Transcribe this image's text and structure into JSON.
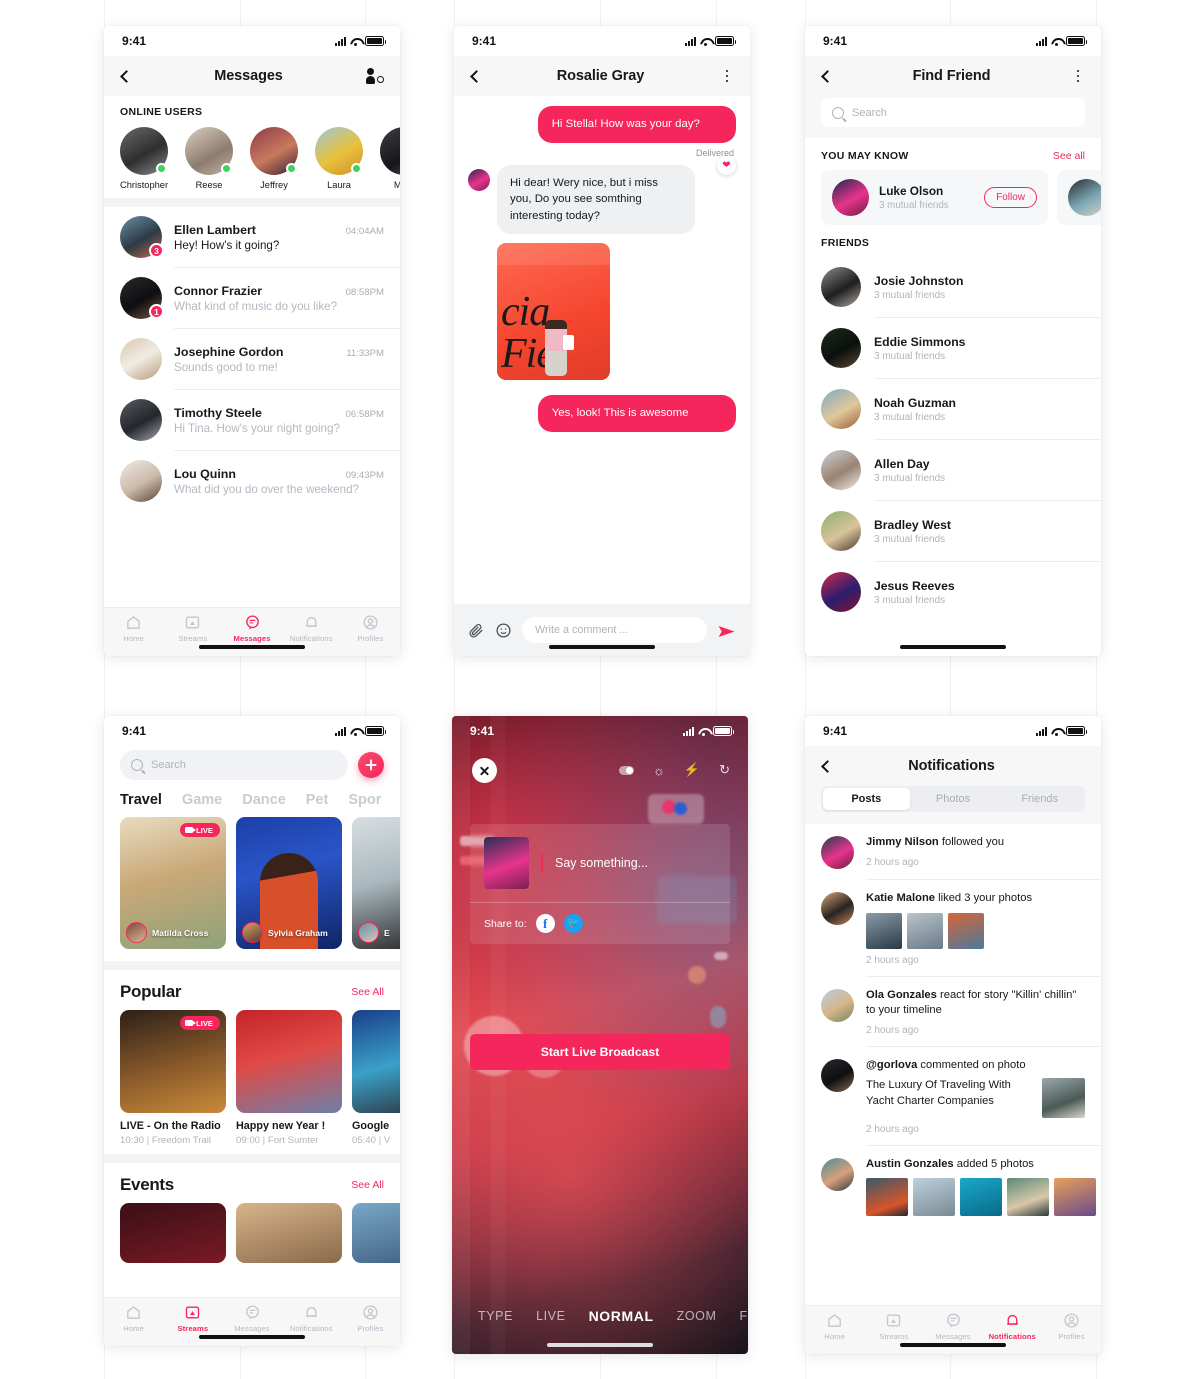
{
  "status_bar": {
    "time": "9:41"
  },
  "screen_messages": {
    "title": "Messages",
    "back_icon": "chevron-left-icon",
    "action_icon": "add-friend-icon",
    "online_label": "ONLINE USERS",
    "online_users": [
      {
        "name": "Christopher"
      },
      {
        "name": "Reese"
      },
      {
        "name": "Jeffrey"
      },
      {
        "name": "Laura"
      },
      {
        "name": "Mald"
      }
    ],
    "conversations": [
      {
        "name": "Ellen Lambert",
        "time": "04:04AM",
        "preview": "Hey! How's it going?",
        "badge": "3",
        "unread": true
      },
      {
        "name": "Connor Frazier",
        "time": "08:58PM",
        "preview": "What kind of music do you like?",
        "badge": "1",
        "unread": false
      },
      {
        "name": "Josephine Gordon",
        "time": "11:33PM",
        "preview": "Sounds good to me!",
        "badge": "",
        "unread": false
      },
      {
        "name": "Timothy Steele",
        "time": "06:58PM",
        "preview": "Hi Tina. How's your night going?",
        "badge": "",
        "unread": false
      },
      {
        "name": "Lou Quinn",
        "time": "09:43PM",
        "preview": "What did you do over the weekend?",
        "badge": "",
        "unread": false
      }
    ],
    "tabs": [
      {
        "label": "Home",
        "icon": "home-icon",
        "active": false
      },
      {
        "label": "Streams",
        "icon": "streams-icon",
        "active": false
      },
      {
        "label": "Messages",
        "icon": "messages-icon",
        "active": true
      },
      {
        "label": "Notifications",
        "icon": "bell-icon",
        "active": false
      },
      {
        "label": "Profiles",
        "icon": "profile-icon",
        "active": false
      }
    ]
  },
  "screen_chat": {
    "title": "Rosalie Gray",
    "back_icon": "chevron-left-icon",
    "menu_icon": "more-vertical-icon",
    "messages": [
      {
        "side": "out",
        "text": "Hi Stella! How was your day?"
      },
      {
        "side": "in",
        "text": "Hi dear! Wery nice, but i miss you, Do you see somthing interesting today?"
      },
      {
        "side": "out",
        "text": "Yes, look! This is awesome"
      }
    ],
    "delivered_label": "Delivered",
    "reaction_icon": "heart-icon",
    "photo_text": "cia Fie",
    "composer": {
      "attach_icon": "paperclip-icon",
      "emoji_icon": "smiley-icon",
      "placeholder": "Write a comment ...",
      "value": "",
      "send_icon": "send-icon"
    }
  },
  "screen_find_friend": {
    "title": "Find Friend",
    "back_icon": "chevron-left-icon",
    "menu_icon": "more-vertical-icon",
    "search": {
      "placeholder": "Search",
      "value": "",
      "icon": "search-icon"
    },
    "you_may_know": {
      "label": "YOU MAY KNOW",
      "see_all": "See all",
      "cards": [
        {
          "name": "Luke Olson",
          "sub": "3 mutual friends",
          "button": "Follow"
        }
      ]
    },
    "friends_label": "FRIENDS",
    "friends": [
      {
        "name": "Josie Johnston",
        "sub": "3 mutual friends"
      },
      {
        "name": "Eddie Simmons",
        "sub": "3 mutual friends"
      },
      {
        "name": "Noah Guzman",
        "sub": "3 mutual friends"
      },
      {
        "name": "Allen Day",
        "sub": "3 mutual friends"
      },
      {
        "name": "Bradley West",
        "sub": "3 mutual friends"
      },
      {
        "name": "Jesus Reeves",
        "sub": "3 mutual friends"
      }
    ]
  },
  "screen_streams": {
    "search": {
      "placeholder": "Search",
      "value": "",
      "icon": "search-icon"
    },
    "add_icon": "plus-icon",
    "categories": [
      {
        "label": "Travel",
        "active": true
      },
      {
        "label": "Game",
        "active": false
      },
      {
        "label": "Dance",
        "active": false
      },
      {
        "label": "Pet",
        "active": false
      },
      {
        "label": "Spor",
        "active": false
      }
    ],
    "stream_cards": [
      {
        "author": "Matilda Cross",
        "live": true,
        "live_label": "LIVE"
      },
      {
        "author": "Sylvia Graham",
        "live": false,
        "live_label": ""
      },
      {
        "author": "E",
        "live": false,
        "live_label": ""
      }
    ],
    "popular": {
      "title": "Popular",
      "see_all": "See All",
      "items": [
        {
          "title": "LIVE - On the Radio",
          "meta": "10:30 | Freedom Trail",
          "live": true,
          "live_label": "LIVE"
        },
        {
          "title": "Happy new Year !",
          "meta": "09:00 | Fort Sumter",
          "live": false,
          "live_label": ""
        },
        {
          "title": "Google",
          "meta": "05:40 | V",
          "live": false,
          "live_label": ""
        }
      ]
    },
    "events": {
      "title": "Events",
      "see_all": "See All"
    },
    "tabs": [
      {
        "label": "Home",
        "icon": "home-icon",
        "active": false
      },
      {
        "label": "Streams",
        "icon": "streams-icon",
        "active": true
      },
      {
        "label": "Messages",
        "icon": "messages-icon",
        "active": false
      },
      {
        "label": "Notifications",
        "icon": "bell-icon",
        "active": false
      },
      {
        "label": "Profiles",
        "icon": "profile-icon",
        "active": false
      }
    ]
  },
  "screen_live": {
    "close_icon": "close-icon",
    "tools": [
      "toggle-icon",
      "brightness-icon",
      "flash-icon",
      "rotate-camera-icon"
    ],
    "say_placeholder": "Say something...",
    "share_label": "Share to:",
    "share_targets": [
      {
        "name": "facebook-icon",
        "glyph": "f"
      },
      {
        "name": "twitter-icon",
        "glyph": "✒"
      }
    ],
    "start_button": "Start Live Broadcast",
    "modes": [
      {
        "label": "TYPE",
        "active": false
      },
      {
        "label": "LIVE",
        "active": false
      },
      {
        "label": "NORMAL",
        "active": true
      },
      {
        "label": "ZOOM",
        "active": false
      },
      {
        "label": "FOCU",
        "active": false
      }
    ]
  },
  "screen_notifications": {
    "title": "Notifications",
    "back_icon": "chevron-left-icon",
    "segments": [
      {
        "label": "Posts",
        "active": true
      },
      {
        "label": "Photos",
        "active": false
      },
      {
        "label": "Friends",
        "active": false
      }
    ],
    "items": [
      {
        "actor": "Jimmy Nilson",
        "action": " followed you",
        "time": "2 hours ago",
        "thumbs": 0
      },
      {
        "actor": "Katie Malone",
        "action": " liked 3 your photos",
        "time": "2 hours ago",
        "thumbs": 3
      },
      {
        "actor": "Ola Gonzales",
        "action": " react for story \"Killin' chillin\" to your timeline",
        "time": "2 hours ago",
        "thumbs": 0
      },
      {
        "actor": "@gorlova",
        "action": " commented on photo",
        "comment": "The Luxury Of Traveling With Yacht Charter Companies",
        "time": "2 hours ago",
        "thumbs": 0
      },
      {
        "actor": "Austin Gonzales",
        "action": " added 5 photos",
        "time": "",
        "thumbs": 5
      }
    ],
    "tabs": [
      {
        "label": "Home",
        "icon": "home-icon",
        "active": false
      },
      {
        "label": "Streams",
        "icon": "streams-icon",
        "active": false
      },
      {
        "label": "Messages",
        "icon": "messages-icon",
        "active": false
      },
      {
        "label": "Notifications",
        "icon": "bell-icon",
        "active": true
      },
      {
        "label": "Profiles",
        "icon": "profile-icon",
        "active": false
      }
    ]
  },
  "colors": {
    "accent": "#f5265c",
    "online": "#41d15f",
    "text": "#16181c",
    "muted": "#b0b4bc"
  }
}
